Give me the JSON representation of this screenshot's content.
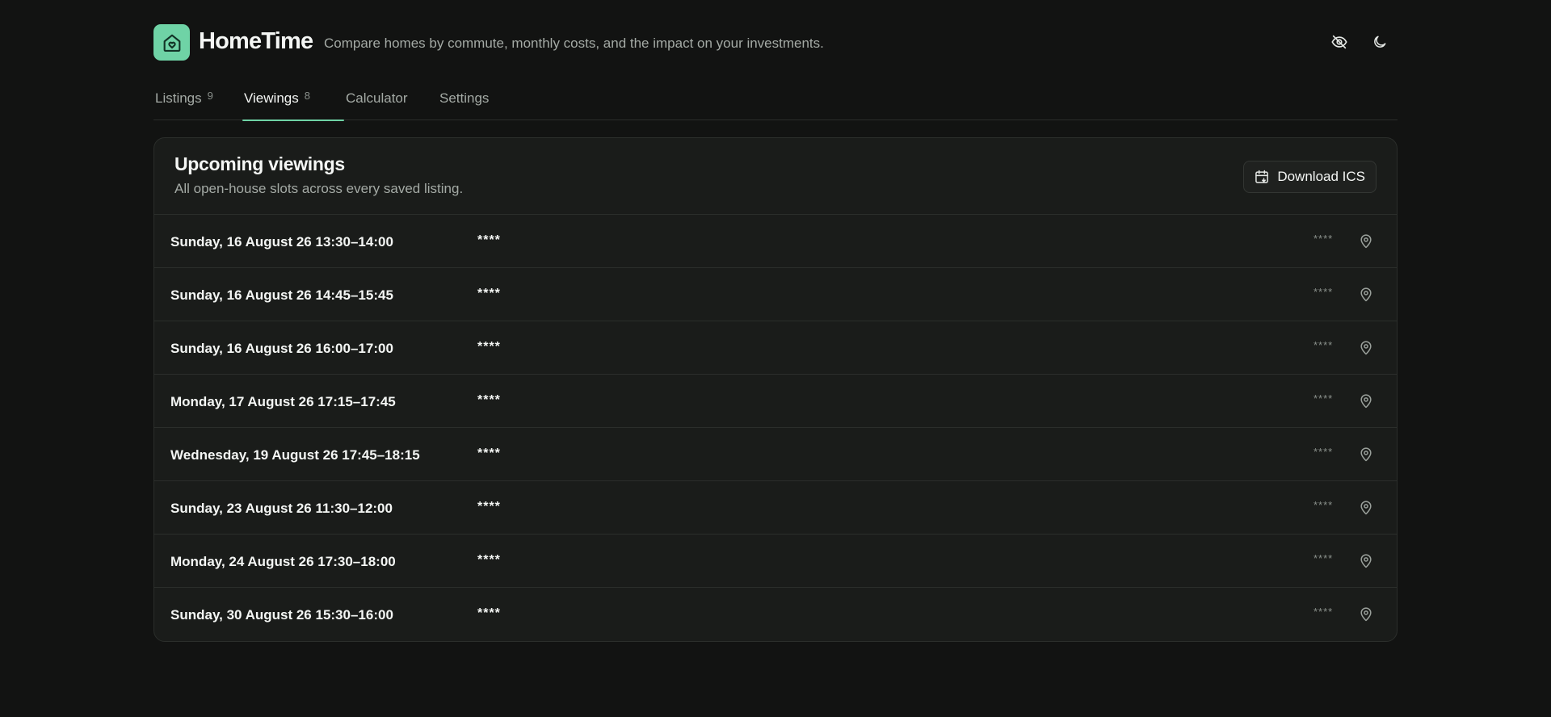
{
  "app": {
    "brand": "HomeTime",
    "tagline": "Compare homes by commute, monthly costs, and the impact on your investments.",
    "accent": "#6fd3a6"
  },
  "header_actions": {
    "hide_icon": "eye-off-icon",
    "theme_icon": "moon-icon"
  },
  "tabs": [
    {
      "label": "Listings",
      "count": "9"
    },
    {
      "label": "Viewings",
      "count": "8"
    },
    {
      "label": "Calculator"
    },
    {
      "label": "Settings"
    }
  ],
  "card": {
    "title": "Upcoming viewings",
    "subtitle": "All open-house slots across every saved listing.",
    "download_label": "Download ICS"
  },
  "viewings": [
    {
      "date": "Sunday, 16 August 26 13:30–14:00",
      "address": "****",
      "meta": "****"
    },
    {
      "date": "Sunday, 16 August 26 14:45–15:45",
      "address": "****",
      "meta": "****"
    },
    {
      "date": "Sunday, 16 August 26 16:00–17:00",
      "address": "****",
      "meta": "****"
    },
    {
      "date": "Monday, 17 August 26 17:15–17:45",
      "address": "****",
      "meta": "****"
    },
    {
      "date": "Wednesday, 19 August 26 17:45–18:15",
      "address": "****",
      "meta": "****"
    },
    {
      "date": "Sunday, 23 August 26 11:30–12:00",
      "address": "****",
      "meta": "****"
    },
    {
      "date": "Monday, 24 August 26 17:30–18:00",
      "address": "****",
      "meta": "****"
    },
    {
      "date": "Sunday, 30 August 26 15:30–16:00",
      "address": "****",
      "meta": "****"
    }
  ]
}
